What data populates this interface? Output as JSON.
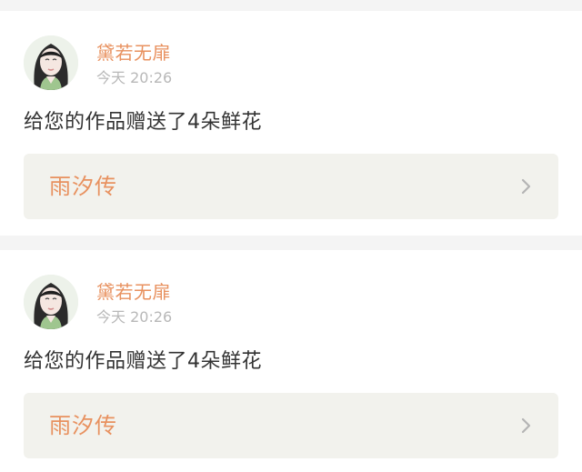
{
  "feed": {
    "items": [
      {
        "author": "黛若无扉",
        "time": "今天 20:26",
        "message": "给您的作品赠送了4朵鲜花",
        "work_title": "雨汐传"
      },
      {
        "author": "黛若无扉",
        "time": "今天 20:26",
        "message": "给您的作品赠送了4朵鲜花",
        "work_title": "雨汐传"
      }
    ]
  },
  "colors": {
    "accent": "#e8915f",
    "background": "#f4f4f4",
    "card": "#ffffff",
    "link_card": "#f2f2ed",
    "muted_text": "#b8b8b8",
    "body_text": "#333333"
  },
  "icons": {
    "avatar": "user-avatar",
    "chevron": "chevron-right-icon"
  }
}
